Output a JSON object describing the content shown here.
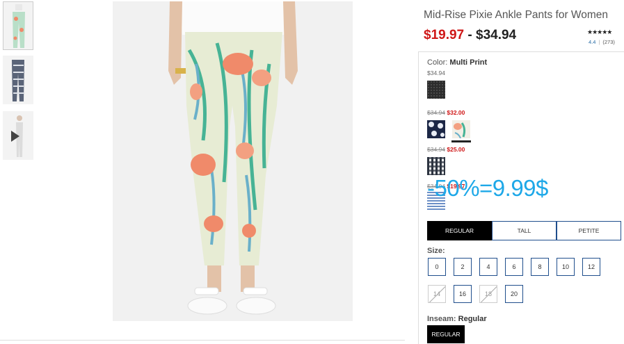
{
  "product": {
    "title": "Mid-Rise Pixie Ankle Pants for Women",
    "price_low": "$19.97",
    "price_sep": " - ",
    "price_high": "$34.94",
    "stars": "★★★★★",
    "rating_value": "4.4",
    "rating_sep": "|",
    "review_count": "(273)"
  },
  "color": {
    "label": "Color:",
    "selected": "Multi Print",
    "groups": [
      {
        "price": "$34.94"
      },
      {
        "old_price": "$34.94",
        "sale_price": "$32.00"
      },
      {
        "old_price": "$34.94",
        "sale_price": "$25.00"
      },
      {
        "old_price": "$34.94",
        "sale_price": "$19.97"
      }
    ]
  },
  "overlay_text": "-50%=9.99$",
  "fits": [
    "REGULAR",
    "TALL",
    "PETITE"
  ],
  "size": {
    "label": "Size:",
    "options": [
      "0",
      "2",
      "4",
      "6",
      "8",
      "10",
      "12",
      "14",
      "16",
      "18",
      "20"
    ],
    "unavailable": [
      "14",
      "18"
    ]
  },
  "inseam": {
    "label": "Inseam:",
    "selected": "Regular",
    "option": "REGULAR"
  },
  "colors": {
    "sale_red": "#cf1717",
    "overlay_blue": "#1ea8e8",
    "border_navy": "#1f4e8c"
  }
}
